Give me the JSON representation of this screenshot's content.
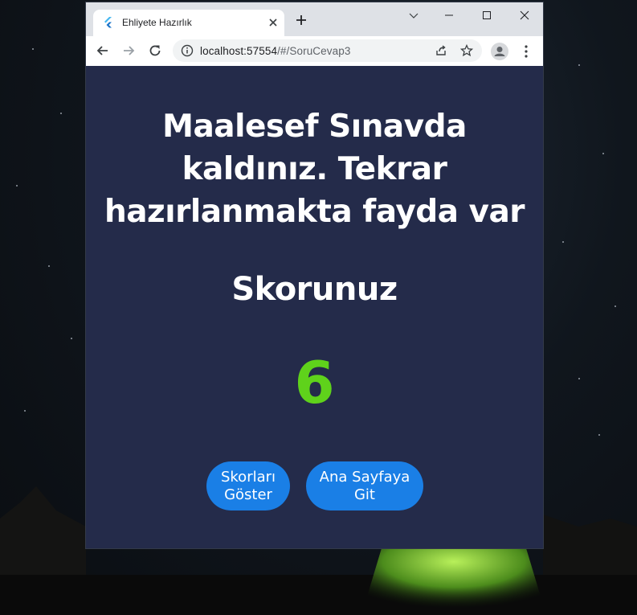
{
  "browser": {
    "tab_title": "Ehliyete Hazırlık",
    "url_host": "localhost:57554",
    "url_path": "/#/SoruCevap3"
  },
  "page": {
    "message": "Maalesef Sınavda kaldınız. Tekrar hazırlanmakta fayda var",
    "score_label": "Skorunuz",
    "score_value": "6",
    "score_color": "#5fd21b",
    "background_color": "#242b4a",
    "buttons": {
      "show_scores_line1": "Skorları",
      "show_scores_line2": "Göster",
      "home_line1": "Ana Sayfaya",
      "home_line2": "Git",
      "color": "#1a7fe6"
    }
  },
  "icons": {
    "tab_favicon": "flutter-icon",
    "tab_close": "close-icon",
    "new_tab": "plus-icon",
    "back": "arrow-left-icon",
    "forward": "arrow-right-icon",
    "reload": "reload-icon",
    "site_info": "info-icon",
    "share": "share-icon",
    "bookmark": "star-icon",
    "profile": "avatar-icon",
    "menu": "kebab-menu-icon"
  }
}
